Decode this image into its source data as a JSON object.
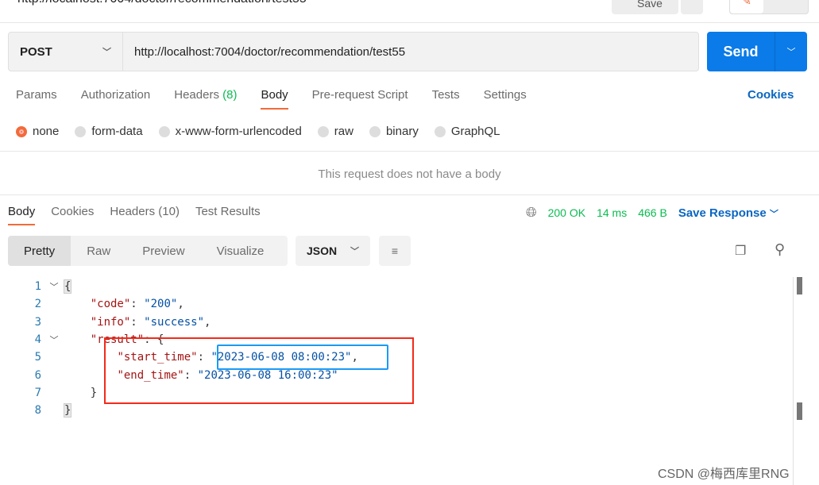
{
  "top": {
    "title": "http://localhost:7004/doctor/recommendation/test55",
    "save_label": "Save"
  },
  "request": {
    "method": "POST",
    "url": "http://localhost:7004/doctor/recommendation/test55",
    "send_label": "Send"
  },
  "req_tabs": [
    {
      "label": "Params"
    },
    {
      "label": "Authorization"
    },
    {
      "label": "Headers",
      "count": "(8)"
    },
    {
      "label": "Body"
    },
    {
      "label": "Pre-request Script"
    },
    {
      "label": "Tests"
    },
    {
      "label": "Settings"
    }
  ],
  "cookies_label": "Cookies",
  "body_types": [
    "none",
    "form-data",
    "x-www-form-urlencoded",
    "raw",
    "binary",
    "GraphQL"
  ],
  "no_body_message": "This request does not have a body",
  "resp_tabs": [
    "Body",
    "Cookies",
    "Headers (10)",
    "Test Results"
  ],
  "status": {
    "code": "200 OK",
    "time": "14 ms",
    "size": "466 B",
    "save_response": "Save Response"
  },
  "views": [
    "Pretty",
    "Raw",
    "Preview",
    "Visualize"
  ],
  "format": "JSON",
  "code_lines": [
    "1",
    "2",
    "3",
    "4",
    "5",
    "6",
    "7",
    "8"
  ],
  "json": {
    "code_key": "\"code\"",
    "code_val": "\"200\"",
    "info_key": "\"info\"",
    "info_val": "\"success\"",
    "result_key": "\"result\"",
    "start_key": "\"start_time\"",
    "start_val": "\"2023-06-08 08:00:23\"",
    "end_key": "\"end_time\"",
    "end_val": "\"2023-06-08 16:00:23\""
  },
  "watermark": "CSDN @梅西库里RNG",
  "colors": {
    "accent": "#f26b3a",
    "primary": "#0a7be8",
    "success": "#0cbb52",
    "highlight_red": "#f52a1a",
    "highlight_blue": "#1a9af5"
  }
}
